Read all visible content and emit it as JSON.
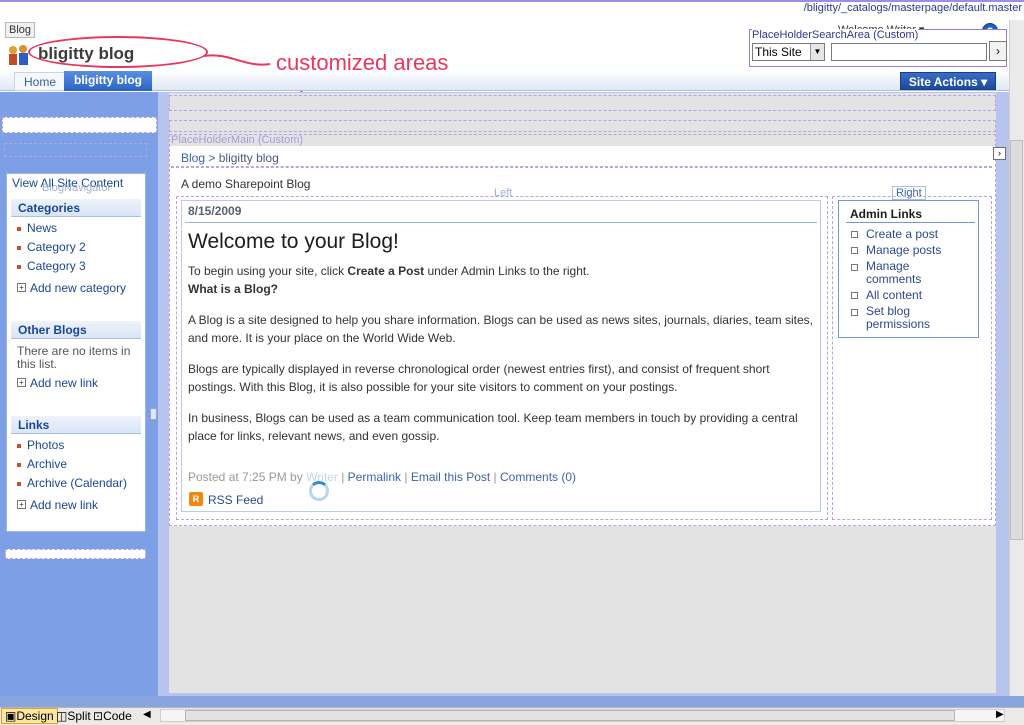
{
  "path": "/bligitty/_catalogs/masterpage/default.master",
  "top_tab": "Blog",
  "welcome": "Welcome Writer ▾",
  "help_glyph": "?",
  "site_title": "bligitty blog",
  "annotation": "customized areas",
  "search": {
    "area_label": "PlaceHolderSearchArea (Custom)",
    "scope": "This Site",
    "go_glyph": "›"
  },
  "nav": {
    "home": "Home",
    "current": "bligitty blog",
    "site_actions": "Site Actions ▾"
  },
  "placeholder_main_label": "PlaceHolderMain (Custom)",
  "breadcrumb": {
    "root": "Blog",
    "sep": ">",
    "current": "bligitty blog"
  },
  "description": "A demo Sharepoint Blog",
  "zones": {
    "left": "Left",
    "right": "Right",
    "blog_navigator": "BlogNavigator"
  },
  "post": {
    "date": "8/15/2009",
    "title": "Welcome to your Blog!",
    "intro_start": "To begin using your site, click ",
    "intro_bold": "Create a Post",
    "intro_end": " under Admin Links to the right.",
    "question": "What is a Blog?",
    "para1": "A Blog is a site designed to help you share information. Blogs can be used as news sites, journals, diaries, team sites, and more. It is your place on the World Wide Web.",
    "para2": "Blogs are typically displayed in reverse chronological order (newest entries first), and consist of frequent short postings. With this Blog, it is also possible for your site visitors to comment on your postings.",
    "para3": "In business, Blogs can be used as a team communication tool. Keep team members in touch by providing a central place for links, relevant news, and even gossip.",
    "footer_prefix": "Posted at 7:25 PM by",
    "footer_author": "Writer",
    "permalink": "Permalink",
    "email": "Email this Post",
    "comments": "Comments (0)",
    "pipe": "|",
    "rss": "RSS Feed",
    "rss_glyph": "R"
  },
  "admin": {
    "title": "Admin Links",
    "items": [
      "Create a post",
      "Manage posts",
      "Manage comments",
      "All content",
      "Set blog permissions"
    ]
  },
  "quicklaunch": {
    "view_all": "View All Site Content",
    "categories_header": "Categories",
    "categories": [
      "News",
      "Category 2",
      "Category 3"
    ],
    "add_category": "Add new category",
    "other_blogs_header": "Other Blogs",
    "no_items": "There are no items in this list.",
    "add_link": "Add new link",
    "links_header": "Links",
    "links": [
      "Photos",
      "Archive",
      "Archive (Calendar)"
    ],
    "add_link2": "Add new link"
  },
  "view_modes": {
    "design": "Design",
    "split": "Split",
    "code": "Code"
  },
  "colors": {
    "accent": "#2a63c6",
    "annotation": "#e8375f",
    "link": "#3a64b0"
  }
}
